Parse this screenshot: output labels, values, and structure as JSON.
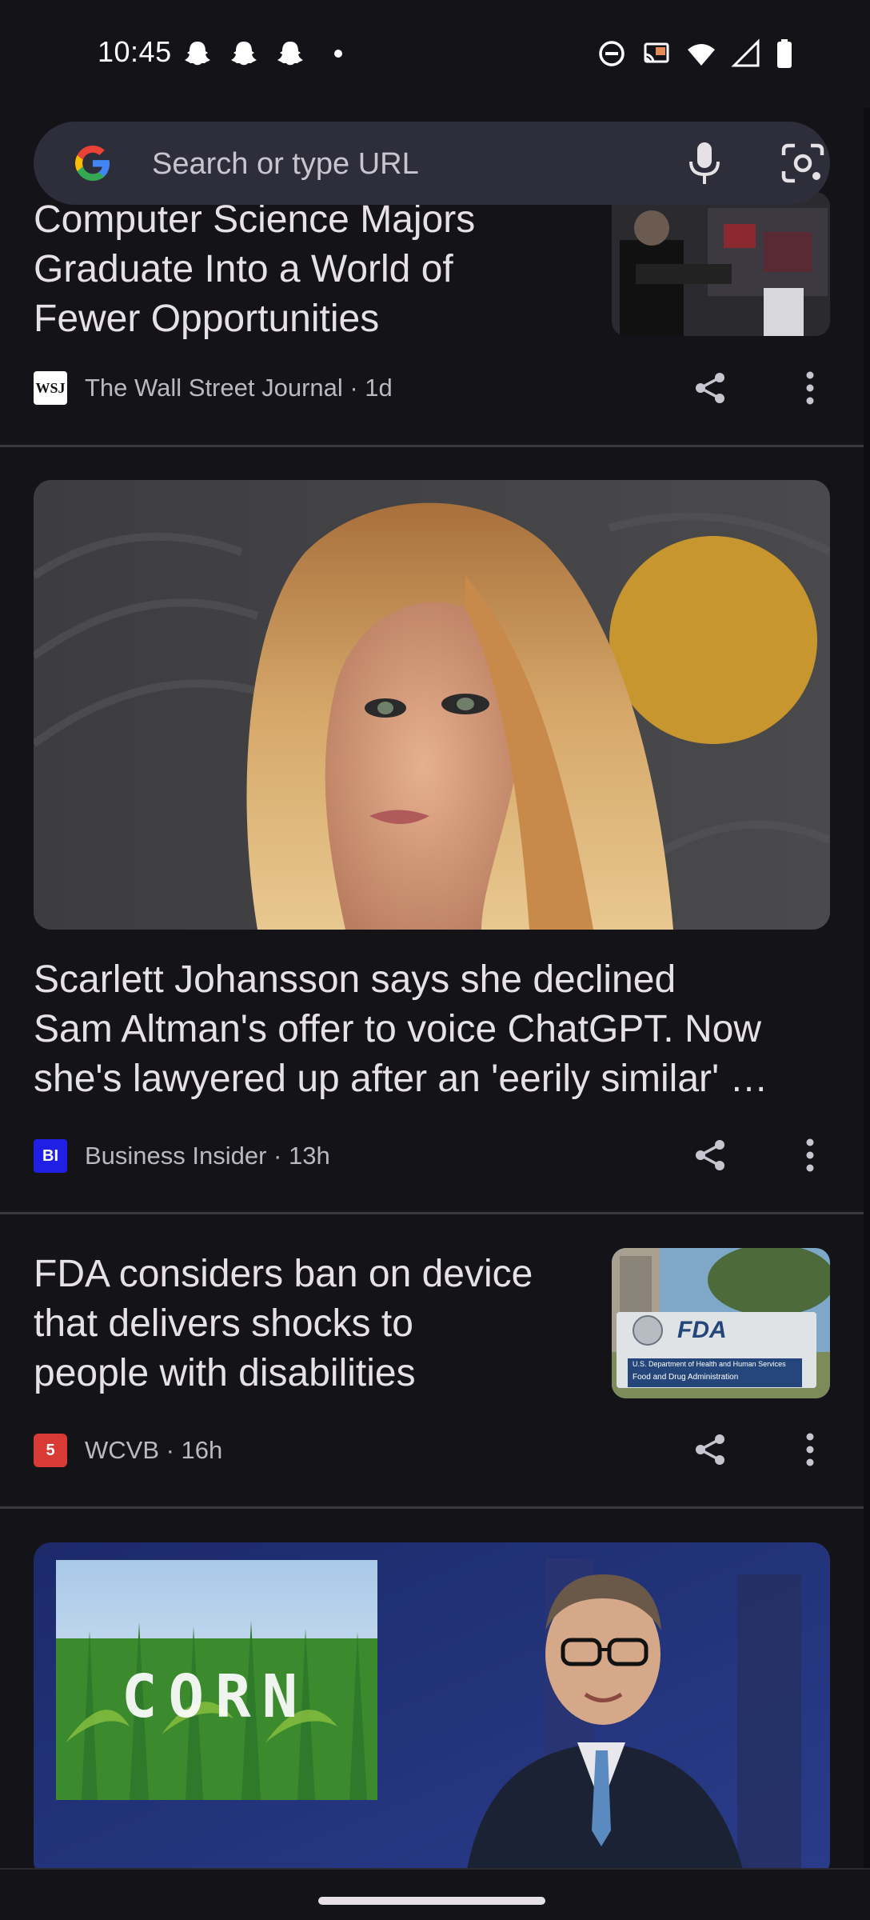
{
  "status_bar": {
    "time": "10:45",
    "left_icons": [
      "snapchat-icon",
      "snapchat-icon",
      "snapchat-icon",
      "dot-icon"
    ],
    "right_icons": [
      "dnd-icon",
      "cast-icon",
      "wifi-icon",
      "signal-icon",
      "battery-icon"
    ]
  },
  "search": {
    "placeholder": "Search or type URL",
    "icons": [
      "google-logo",
      "mic-icon",
      "google-lens-icon"
    ]
  },
  "feed": {
    "articles": [
      {
        "headline_lines": [
          "Computer Science Majors",
          "Graduate Into a World of",
          "Fewer Opportunities"
        ],
        "source": "The Wall Street Journal",
        "age": "1d",
        "source_meta": "The Wall Street Journal · 1d",
        "logo_text": "WSJ"
      },
      {
        "headline_lines": [
          "Scarlett Johansson says she declined",
          "Sam Altman's offer to voice ChatGPT. Now",
          "she's lawyered up after an 'eerily similar' …"
        ],
        "source": "Business Insider",
        "age": "13h",
        "source_meta": "Business Insider · 13h",
        "logo_text": "BI"
      },
      {
        "headline_lines": [
          "FDA considers ban on device",
          "that delivers shocks to",
          "people with disabilities"
        ],
        "source": "WCVB",
        "age": "16h",
        "source_meta": "WCVB · 16h",
        "logo_text": "5",
        "image_text": {
          "sign_logo": "FDA",
          "sign_line1": "U.S. Department of Health and Human Services",
          "sign_line2": "Food and Drug Administration"
        }
      },
      {
        "image_text": {
          "corn": "CORN"
        }
      }
    ]
  },
  "colors": {
    "background": "#141318",
    "search_bg": "#2e2d3a",
    "bi_blue": "#1f1fe6",
    "wcvb_red": "#d83a36"
  }
}
